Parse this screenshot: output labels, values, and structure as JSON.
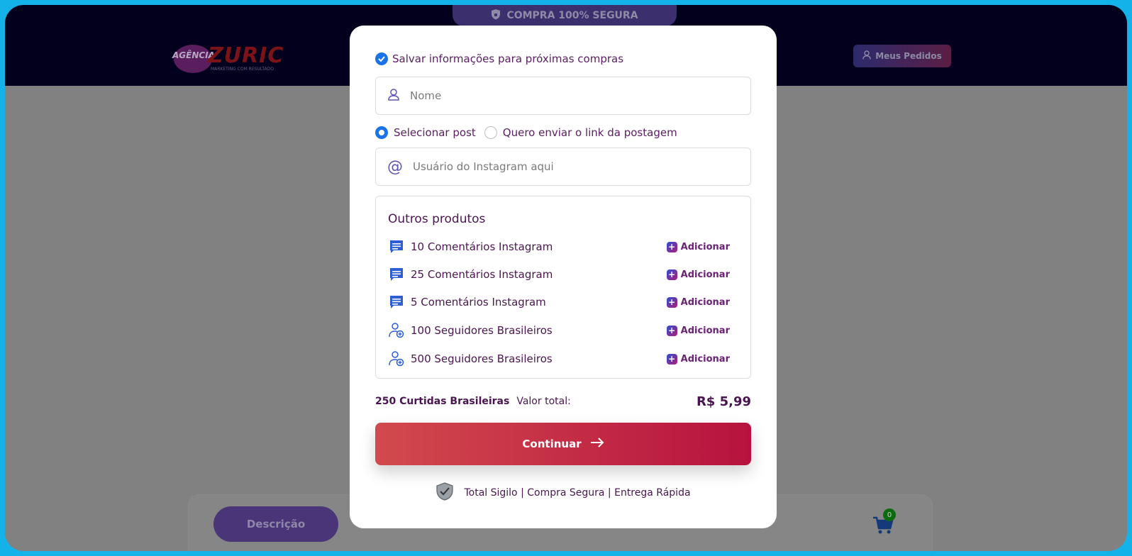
{
  "header": {
    "secure_badge": "COMPRA 100% SEGURA",
    "logo": {
      "line1": "AGÊNCIA",
      "line2": "ZURIC",
      "tagline": "MARKETING COM RESULTADO"
    },
    "orders_button": "Meus Pedidos"
  },
  "page": {
    "description_tab": "Descrição",
    "cart_count": "0"
  },
  "modal": {
    "save_info_label": "Salvar informações para próximas compras",
    "name_field": {
      "placeholder": "Nome",
      "value": ""
    },
    "post_mode": {
      "options": [
        {
          "label": "Selecionar post",
          "selected": true
        },
        {
          "label": "Quero enviar o link da postagem",
          "selected": false
        }
      ]
    },
    "instagram_field": {
      "placeholder": "Usuário do Instagram aqui",
      "value": ""
    },
    "other_products": {
      "title": "Outros produtos",
      "items": [
        {
          "name": "10 Comentários Instagram",
          "icon": "comment-icon",
          "action": "Adicionar"
        },
        {
          "name": "25 Comentários Instagram",
          "icon": "comment-icon",
          "action": "Adicionar"
        },
        {
          "name": "5 Comentários Instagram",
          "icon": "comment-icon",
          "action": "Adicionar"
        },
        {
          "name": "100 Seguidores Brasileiros",
          "icon": "add-user-icon",
          "action": "Adicionar"
        },
        {
          "name": "500 Seguidores Brasileiros",
          "icon": "add-user-icon",
          "action": "Adicionar"
        }
      ]
    },
    "summary": {
      "product": "250 Curtidas Brasileiras",
      "total_label": "Valor total:",
      "total_value": "R$ 5,99"
    },
    "continue_button": "Continuar",
    "footer_text": "Total Sigilo | Compra Segura | Entrega Rápida"
  },
  "colors": {
    "overlay": "#818181",
    "topbar": "#03001e",
    "accent_blue": "#1a73e8",
    "text_purple": "#4a1550",
    "cta_start": "#d24a4d",
    "cta_end": "#b7123f",
    "frame_border": "#13b3ea"
  }
}
